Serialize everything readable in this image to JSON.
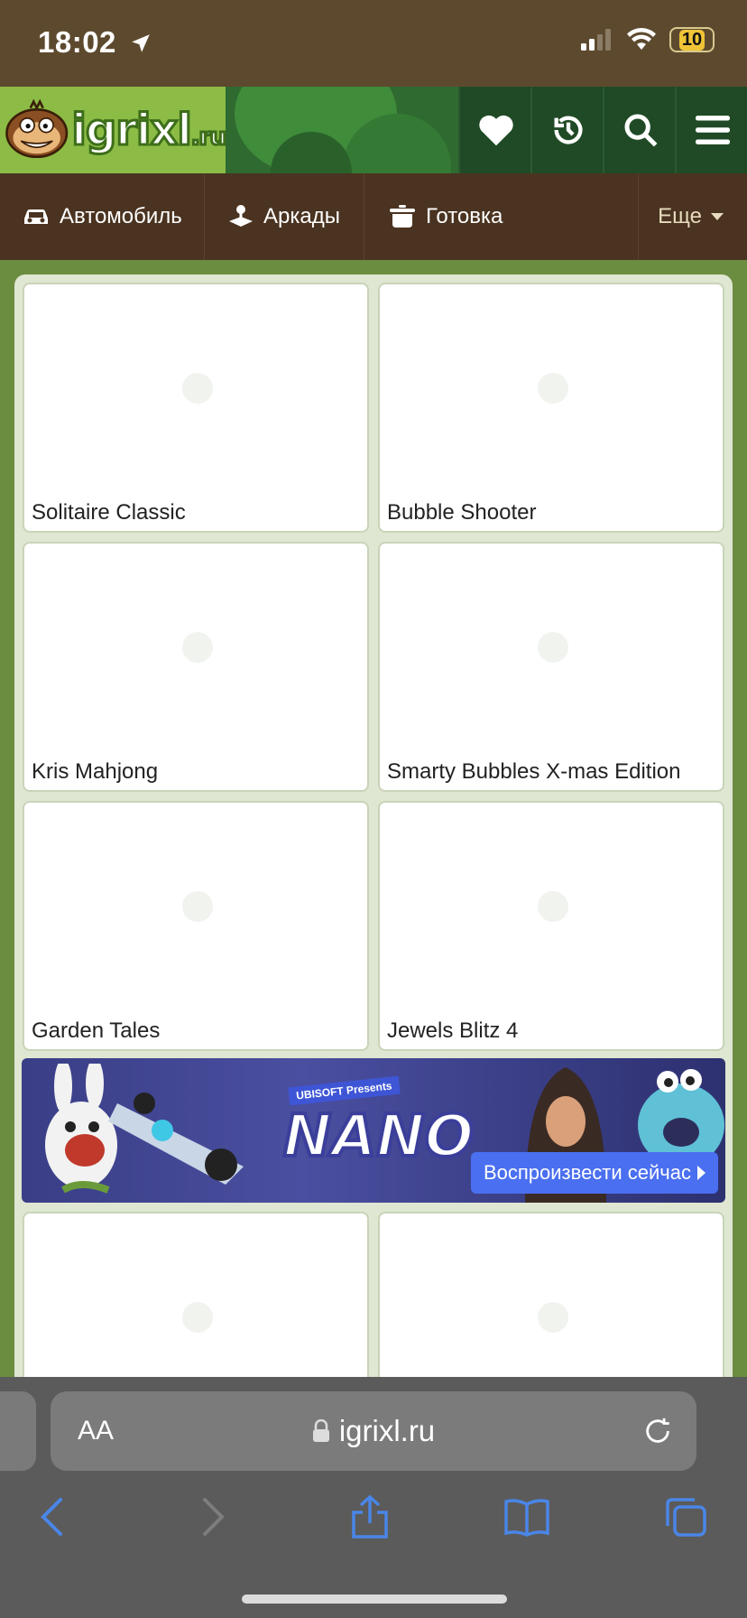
{
  "status_bar": {
    "time": "18:02",
    "battery": "10"
  },
  "site": {
    "logo_text": "igrixl",
    "logo_suffix": ".ru"
  },
  "categories": [
    {
      "label": "Автомобиль",
      "icon": "car-icon"
    },
    {
      "label": "Аркады",
      "icon": "joystick-icon"
    },
    {
      "label": "Готовка",
      "icon": "cooking-pot-icon"
    }
  ],
  "more_label": "Еще",
  "games": [
    {
      "title": "Solitaire Classic"
    },
    {
      "title": "Bubble Shooter"
    },
    {
      "title": "Kris Mahjong"
    },
    {
      "title": "Smarty Bubbles X-mas Edition"
    },
    {
      "title": "Garden Tales"
    },
    {
      "title": "Jewels Blitz 4"
    },
    {
      "title": ""
    },
    {
      "title": ""
    }
  ],
  "banner": {
    "presenter": "UBISOFT Presents",
    "brand": "NANO",
    "cta": "Воспроизвести сейчас"
  },
  "browser": {
    "aa_label": "AA",
    "url": "igrixl.ru"
  },
  "colors": {
    "header_green": "#2f6a30",
    "category_brown": "#4a3320",
    "page_green": "#6b8d3f",
    "cta_blue": "#4a6ff0"
  }
}
